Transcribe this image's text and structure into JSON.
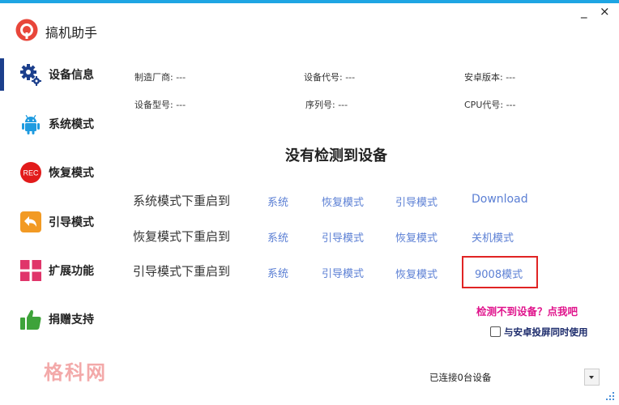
{
  "window": {
    "minimize": "_",
    "close": "×"
  },
  "app": {
    "title": "搞机助手"
  },
  "sidebar": {
    "items": [
      {
        "label": "设备信息",
        "icon": "gear-icon",
        "active": true
      },
      {
        "label": "系统模式",
        "icon": "android-icon"
      },
      {
        "label": "恢复模式",
        "icon": "rec-icon",
        "icon_text": "REC"
      },
      {
        "label": "引导模式",
        "icon": "back-arrow-icon"
      },
      {
        "label": "扩展功能",
        "icon": "grid-icon"
      },
      {
        "label": "捐赠支持",
        "icon": "thumbs-up-icon"
      }
    ]
  },
  "device_info": {
    "manufacturer": "制造厂商: ---",
    "device_code": "设备代号: ---",
    "android_version": "安卓版本: ---",
    "model": "设备型号: ---",
    "serial": "序列号: ---",
    "cpu": "CPU代号: ---"
  },
  "status": {
    "headline": "没有检测到设备"
  },
  "reboot": {
    "rows": [
      {
        "label": "系统模式下重启到",
        "options": [
          "系统",
          "恢复模式",
          "引导模式",
          "Download"
        ]
      },
      {
        "label": "恢复模式下重启到",
        "options": [
          "系统",
          "引导模式",
          "恢复模式",
          "关机模式"
        ]
      },
      {
        "label": "引导模式下重启到",
        "options": [
          "系统",
          "引导模式",
          "恢复模式",
          "9008模式"
        ]
      }
    ]
  },
  "help_link": "检测不到设备？点我吧",
  "screen_cast": {
    "label": "与安卓投屏同时使用",
    "checked": false
  },
  "watermark": "格科网",
  "footer": {
    "connected": "已连接0台设备"
  },
  "colors": {
    "accent": "#1ea5e3",
    "link": "#5b7fd4",
    "pink": "#e0148c",
    "highlight": "#e02424"
  }
}
